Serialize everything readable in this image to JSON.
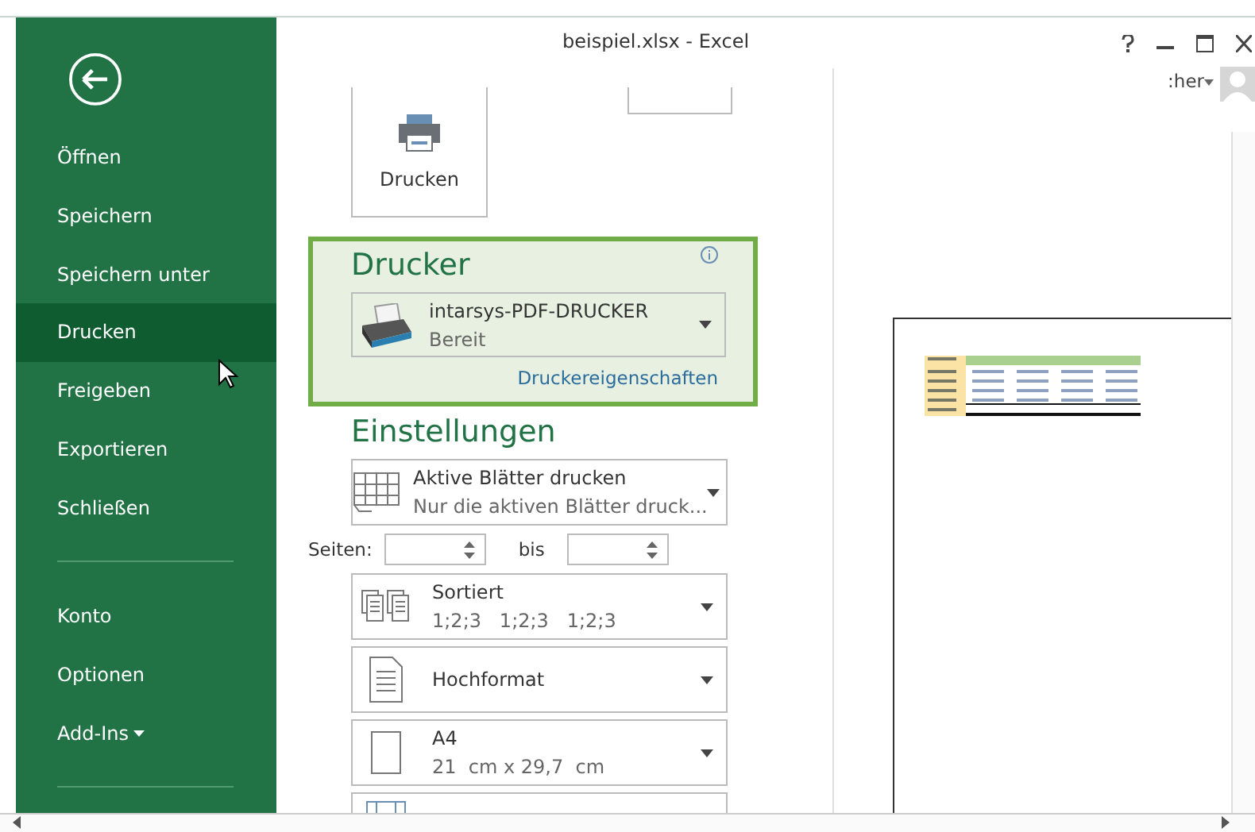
{
  "window": {
    "title": "beispiel.xlsx - Excel",
    "user_name": ":her"
  },
  "sidebar": {
    "sections": [
      {
        "items": [
          {
            "label": "Öffnen",
            "selected": false
          },
          {
            "label": "Speichern",
            "selected": false
          },
          {
            "label": "Speichern unter",
            "selected": false
          },
          {
            "label": "Drucken",
            "selected": true
          },
          {
            "label": "Freigeben",
            "selected": false
          },
          {
            "label": "Exportieren",
            "selected": false
          },
          {
            "label": "Schließen",
            "selected": false
          }
        ]
      },
      {
        "items": [
          {
            "label": "Konto",
            "selected": false
          },
          {
            "label": "Optionen",
            "selected": false
          },
          {
            "label": "Add-Ins",
            "selected": false,
            "has_menu": true
          }
        ]
      }
    ]
  },
  "print_button": {
    "label": "Drucken"
  },
  "printer": {
    "heading": "Drucker",
    "name": "intarsys-PDF-DRUCKER",
    "status": "Bereit",
    "properties_link": "Druckereigenschaften"
  },
  "settings": {
    "heading": "Einstellungen",
    "rows": [
      {
        "kind": "sheets",
        "title": "Aktive Blätter drucken",
        "subtitle": "Nur die aktiven Blätter druck..."
      },
      {
        "kind": "pages",
        "label": "Seiten:",
        "to_label": "bis"
      },
      {
        "kind": "collation",
        "title": "Sortiert",
        "subtitle": "1;2;3   1;2;3   1;2;3"
      },
      {
        "kind": "orientation",
        "title": "Hochformat"
      },
      {
        "kind": "paper",
        "title": "A4",
        "subtitle": "21  cm x 29,7  cm"
      },
      {
        "kind": "margins"
      }
    ]
  }
}
